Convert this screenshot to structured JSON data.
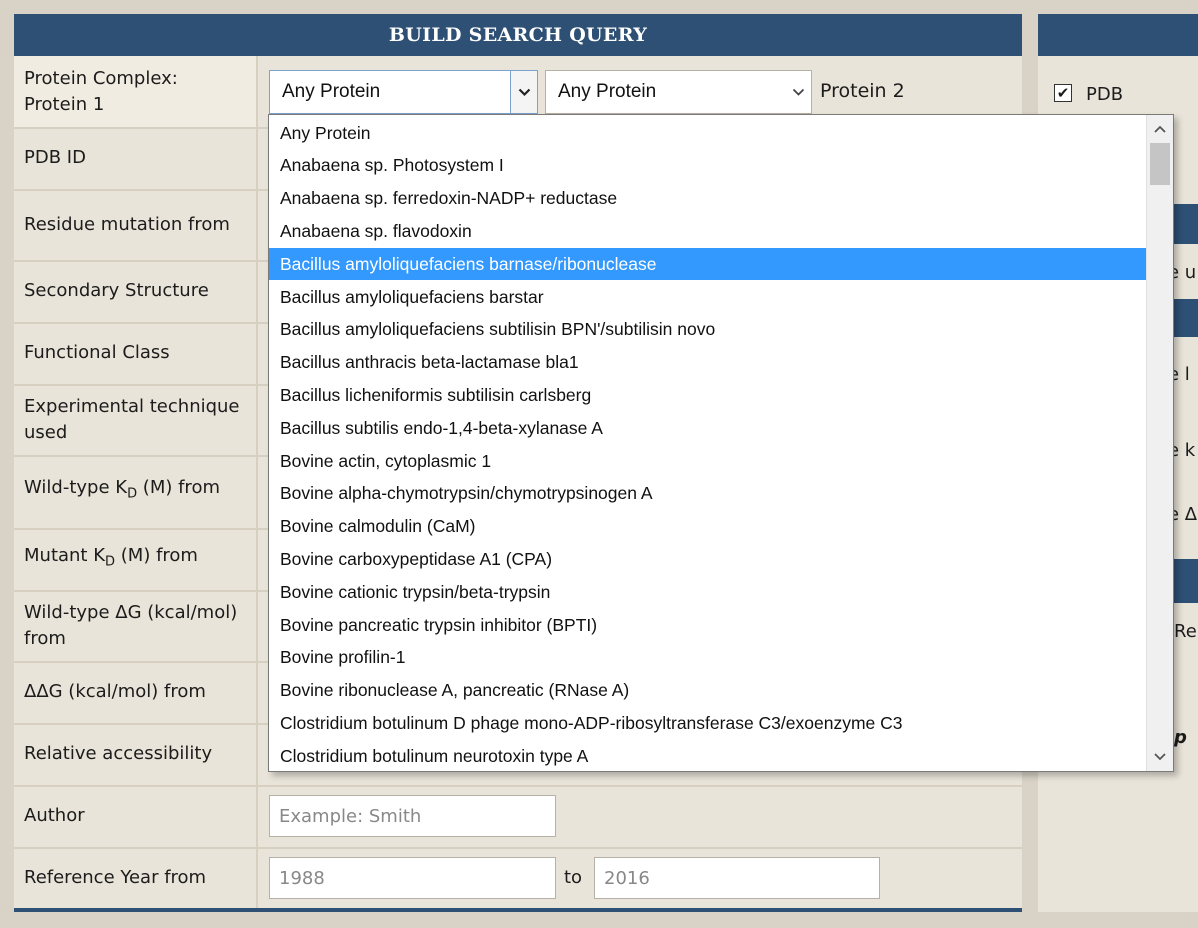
{
  "header": {
    "title": "BUILD SEARCH QUERY"
  },
  "rows": [
    {
      "label": "Protein Complex: Protein 1"
    },
    {
      "label": "PDB ID"
    },
    {
      "label": "Residue mutation from"
    },
    {
      "label": "Secondary Structure"
    },
    {
      "label": "Functional Class"
    },
    {
      "label": "Experimental technique used"
    },
    {
      "label_pre": "Wild-type K",
      "label_sub": "D",
      "label_post": " (M) from"
    },
    {
      "label_pre": "Mutant K",
      "label_sub": "D",
      "label_post": " (M) from"
    },
    {
      "label": "Wild-type ΔG (kcal/mol) from"
    },
    {
      "label": "ΔΔG (kcal/mol) from"
    },
    {
      "label": "Relative accessibility"
    },
    {
      "label": "Author"
    },
    {
      "label": "Reference Year from"
    }
  ],
  "protein1": {
    "selected": "Any Protein"
  },
  "protein2": {
    "selected": "Any Protein",
    "label": "Protein 2"
  },
  "author": {
    "placeholder": "Example: Smith"
  },
  "reference_year": {
    "from": "1988",
    "to_label": "to",
    "to": "2016"
  },
  "dropdown": {
    "selected_index": 4,
    "options": [
      "Any Protein",
      "Anabaena sp. Photosystem I",
      "Anabaena sp. ferredoxin-NADP+ reductase",
      "Anabaena sp. flavodoxin",
      "Bacillus amyloliquefaciens barnase/ribonuclease",
      "Bacillus amyloliquefaciens barstar",
      "Bacillus amyloliquefaciens subtilisin BPN'/subtilisin novo",
      "Bacillus anthracis beta-lactamase bla1",
      "Bacillus licheniformis subtilisin carlsberg",
      "Bacillus subtilis endo-1,4-beta-xylanase A",
      "Bovine actin, cytoplasmic 1",
      "Bovine alpha-chymotrypsin/chymotrypsinogen A",
      "Bovine calmodulin (CaM)",
      "Bovine carboxypeptidase A1 (CPA)",
      "Bovine cationic trypsin/beta-trypsin",
      "Bovine pancreatic trypsin inhibitor (BPTI)",
      "Bovine profilin-1",
      "Bovine ribonuclease A, pancreatic (RNase A)",
      "Clostridium botulinum D phage mono-ADP-ribosyltransferase C3/exoenzyme C3",
      "Clostridium botulinum neurotoxin type A"
    ]
  },
  "right_panel": {
    "pdb_label": "PDB",
    "pdb_checked": true,
    "fragments": [
      "e u",
      "e l",
      "e k",
      "e Δ",
      "Re",
      "p"
    ]
  },
  "colors": {
    "header_bg": "#2d5074",
    "selected_bg": "#3399ff",
    "panel_bg": "#e9e4d9"
  },
  "icons": {
    "select_arrow": "chevron-down-icon",
    "scroll_up": "chevron-up-icon",
    "checkbox": "check-icon"
  }
}
